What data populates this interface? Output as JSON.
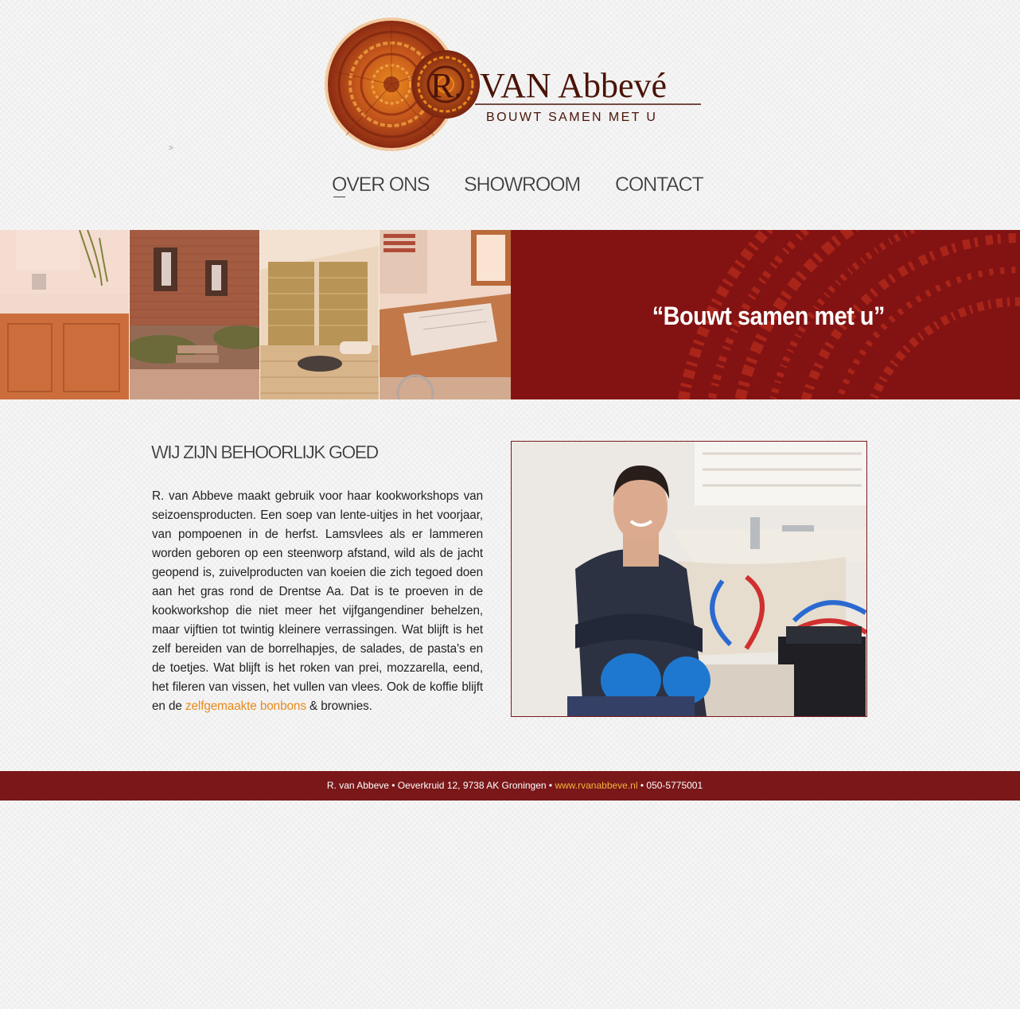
{
  "logo": {
    "initial": "R.",
    "name": "VAN Abbevé",
    "tagline": "BOUWT SAMEN MET U"
  },
  "breadcrumb": {
    "separator": ">"
  },
  "nav": {
    "items": [
      {
        "label": "OVER ONS",
        "active": true
      },
      {
        "label": "SHOWROOM",
        "active": false
      },
      {
        "label": "CONTACT",
        "active": false
      }
    ]
  },
  "banner": {
    "tagline": "“Bouwt samen met u”",
    "photos": [
      "bathroom",
      "brick-house",
      "attic-insulation",
      "drafting-table"
    ],
    "color": "#8a1415"
  },
  "content": {
    "heading": "WIJ ZIJN BEHOORLIJK GOED",
    "paragraph_before": "R. van Abbeve maakt gebruik voor haar kookworkshops van seizoensproducten. Een soep van lente-uitjes in het voorjaar, van pompoenen in de herfst. Lamsvlees als er lammeren worden geboren op een steenworp afstand, wild als de jacht geopend is, zuivelproducten van koeien die zich tegoed doen aan het gras rond de Drentse Aa. Dat is te proeven in de kookworkshop die niet meer het vijfgangendiner behelzen, maar vijftien tot twintig kleinere verrassingen. Wat blijft is het zelf bereiden van de borrelhapjes, de salades, de pasta's en de toetjes. Wat blijft is het roken van prei, mozzarella, eend, het fileren van vissen, het vullen van vlees. Ook de koffie blijft en de ",
    "link_text": "zelfgemaakte bonbons",
    "paragraph_after": " & brownies.",
    "link_color": "#e88a1a",
    "photo": "plumber-sitting-by-bathtub"
  },
  "footer": {
    "company": "R. van Abbeve",
    "separator": " • ",
    "address": "Oeverkruid 12, 9738 AK Groningen",
    "website": "www.rvanabbeve.nl",
    "phone": "050-5775001",
    "background": "#7a1719"
  }
}
